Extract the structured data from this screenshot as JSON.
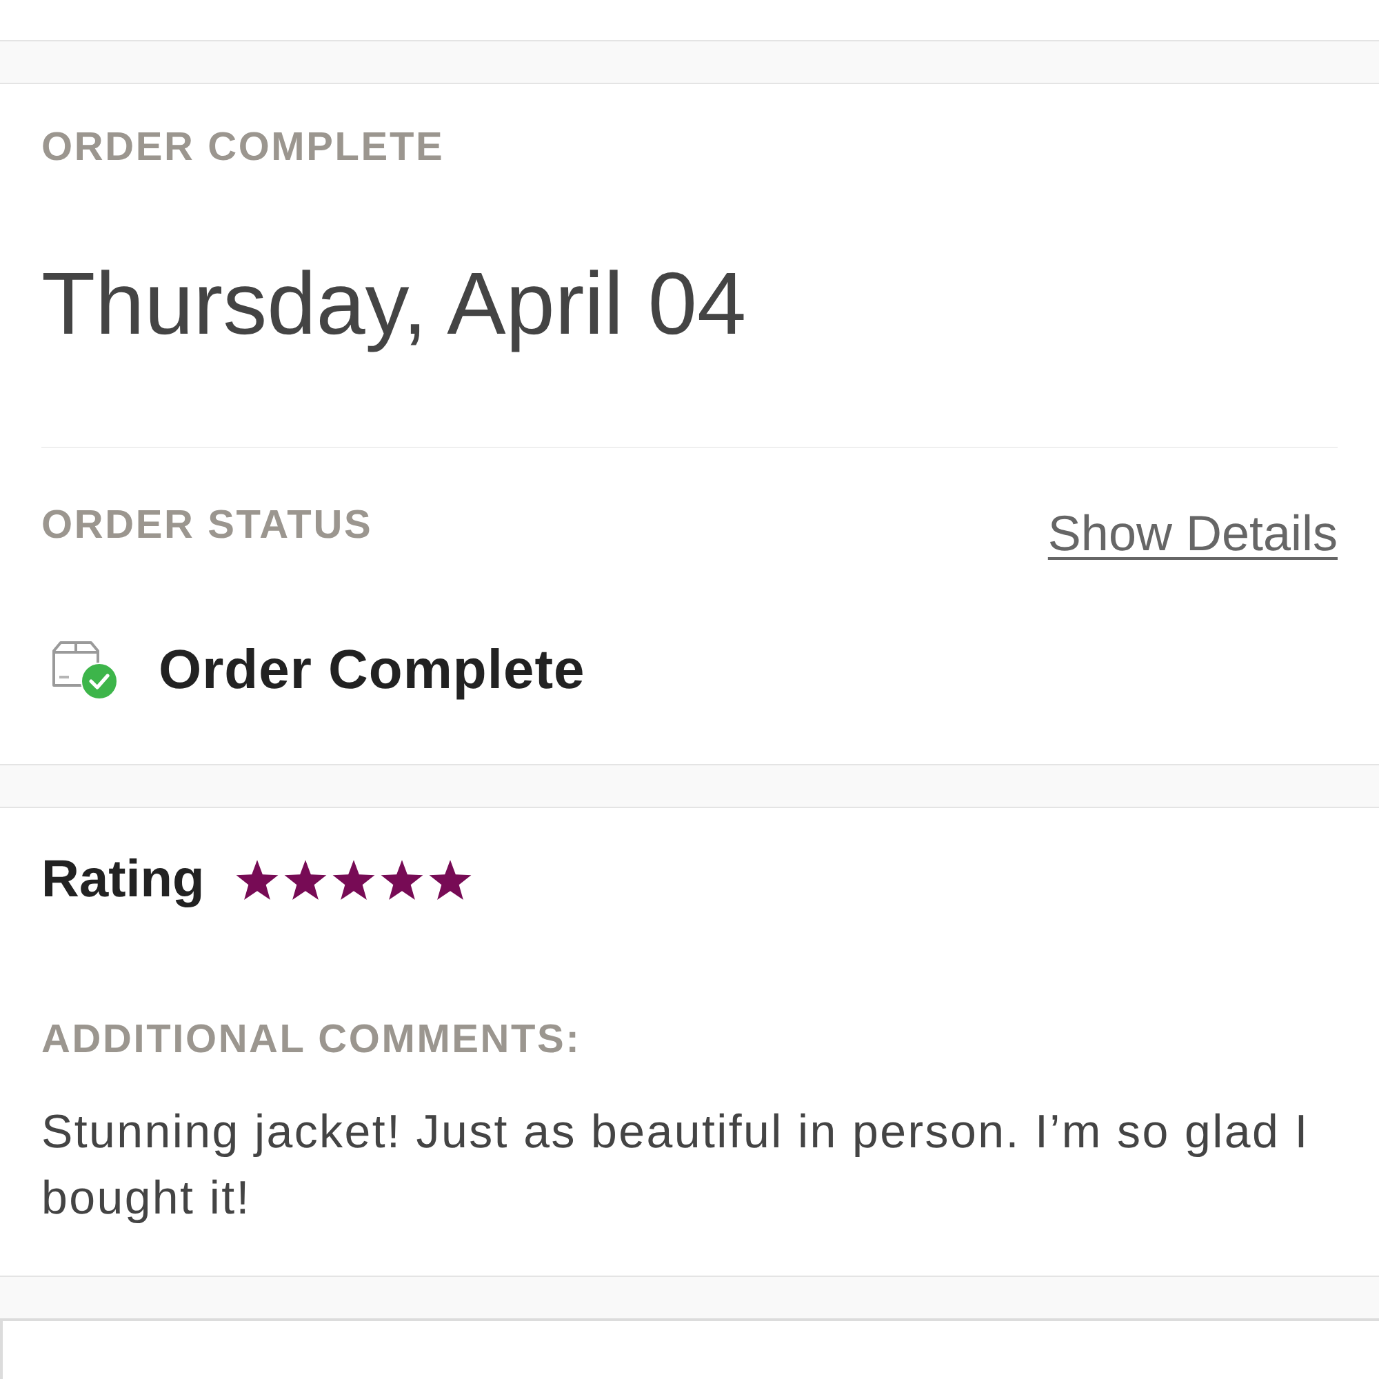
{
  "order_card": {
    "heading": "ORDER COMPLETE",
    "date": "Thursday, April 04",
    "status_label": "ORDER STATUS",
    "details_link": "Show Details",
    "status": {
      "kind": "complete",
      "text": "Order Complete"
    }
  },
  "review_card": {
    "rating_label": "Rating",
    "stars": 5,
    "comments_label": "ADDITIONAL COMMENTS:",
    "comment": "Stunning jacket! Just as beautiful in person. I’m so glad I bought it!"
  }
}
